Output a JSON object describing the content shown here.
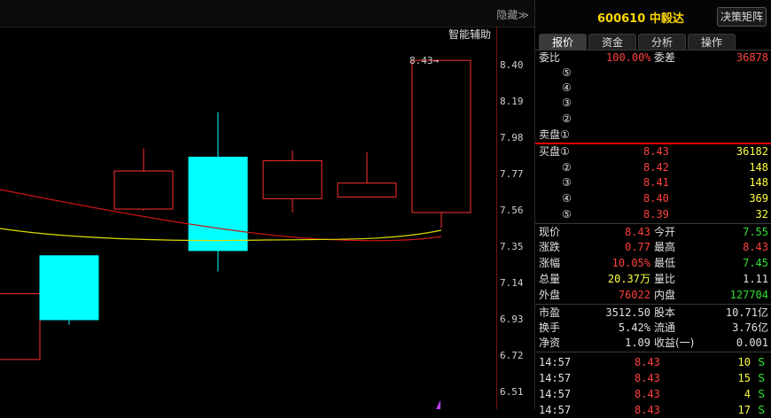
{
  "chart": {
    "hide_label": "隐藏≫",
    "assist_label": "智能辅助",
    "price_marker": "8.43",
    "y_ticks": [
      "8.40",
      "8.19",
      "7.98",
      "7.77",
      "7.56",
      "7.35",
      "7.14",
      "6.93",
      "6.72",
      "6.51"
    ],
    "candles": [
      {
        "open": 6.7,
        "close": 7.08,
        "high": 7.08,
        "low": 6.7
      },
      {
        "open": 7.3,
        "close": 6.93,
        "high": 7.3,
        "low": 6.9
      },
      {
        "open": 7.57,
        "close": 7.79,
        "high": 7.92,
        "low": 7.56
      },
      {
        "open": 7.87,
        "close": 7.33,
        "high": 8.13,
        "low": 7.21
      },
      {
        "open": 7.63,
        "close": 7.85,
        "high": 7.91,
        "low": 7.55
      },
      {
        "open": 7.64,
        "close": 7.72,
        "high": 7.9,
        "low": 7.64
      },
      {
        "open": 7.55,
        "close": 8.43,
        "high": 8.43,
        "low": 7.46
      }
    ],
    "colors": {
      "up": "#ff3030",
      "down": "#00ffff",
      "ma_red": "#c81414",
      "ma_yellow": "#dcdc00"
    }
  },
  "panel": {
    "stock_code": "600610",
    "stock_name": "中毅达",
    "decision_btn": "决策矩阵",
    "tabs": [
      "报价",
      "资金",
      "分析",
      "操作"
    ],
    "weibi_label": "委比",
    "weibi_value": "100.00%",
    "weicha_label": "委差",
    "weicha_value": "36878",
    "sell_levels": [
      "⑤",
      "④",
      "③",
      "②"
    ],
    "sell_label": "卖盘①",
    "buy_label": "买盘①",
    "buy": [
      {
        "lvl": "",
        "price": "8.43",
        "vol": "36182"
      },
      {
        "lvl": "②",
        "price": "8.42",
        "vol": "148"
      },
      {
        "lvl": "③",
        "price": "8.41",
        "vol": "148"
      },
      {
        "lvl": "④",
        "price": "8.40",
        "vol": "369"
      },
      {
        "lvl": "⑤",
        "price": "8.39",
        "vol": "32"
      }
    ],
    "stats": [
      {
        "l1": "现价",
        "v1": "8.43",
        "c1": "red",
        "l2": "今开",
        "v2": "7.55",
        "c2": "green"
      },
      {
        "l1": "涨跌",
        "v1": "0.77",
        "c1": "red",
        "l2": "最高",
        "v2": "8.43",
        "c2": "red"
      },
      {
        "l1": "涨幅",
        "v1": "10.05%",
        "c1": "red",
        "l2": "最低",
        "v2": "7.45",
        "c2": "green"
      },
      {
        "l1": "总量",
        "v1": "20.37万",
        "c1": "yellow",
        "l2": "量比",
        "v2": "1.11",
        "c2": "white"
      },
      {
        "l1": "外盘",
        "v1": "76022",
        "c1": "red",
        "l2": "内盘",
        "v2": "127704",
        "c2": "green"
      }
    ],
    "fund": [
      {
        "l1": "市盈",
        "v1": "3512.50",
        "l2": "股本",
        "v2": "10.71亿"
      },
      {
        "l1": "换手",
        "v1": "5.42%",
        "l2": "流通",
        "v2": "3.76亿"
      },
      {
        "l1": "净资",
        "v1": "1.09",
        "l2": "收益(一)",
        "v2": "0.001"
      }
    ],
    "ticks": [
      {
        "time": "14:57",
        "price": "8.43",
        "vol": "10",
        "side": "S"
      },
      {
        "time": "14:57",
        "price": "8.43",
        "vol": "15",
        "side": "S"
      },
      {
        "time": "14:57",
        "price": "8.43",
        "vol": "4",
        "side": "S"
      },
      {
        "time": "14:57",
        "price": "8.43",
        "vol": "17",
        "side": "S"
      }
    ]
  }
}
